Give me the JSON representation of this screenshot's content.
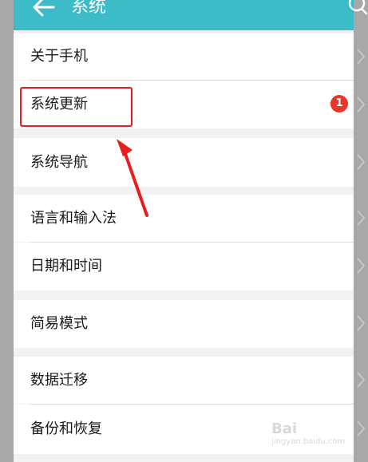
{
  "appbar": {
    "title": "系统"
  },
  "items": [
    {
      "label": "关于手机"
    },
    {
      "label": "系统更新"
    },
    {
      "label": "系统导航"
    },
    {
      "label": "语言和输入法"
    },
    {
      "label": "日期和时间"
    },
    {
      "label": "简易模式"
    },
    {
      "label": "数据迁移"
    },
    {
      "label": "备份和恢复"
    }
  ],
  "badge": {
    "count": "1"
  },
  "watermark": {
    "line1": "Bai",
    "line2": "jingyan.baidu.com"
  },
  "colors": {
    "appbar": "#3cbcc8",
    "badge": "#e8362b",
    "highlight": "#e81d1d"
  },
  "icons": [
    "back-arrow-icon",
    "search-icon",
    "chevron-right-icon"
  ]
}
